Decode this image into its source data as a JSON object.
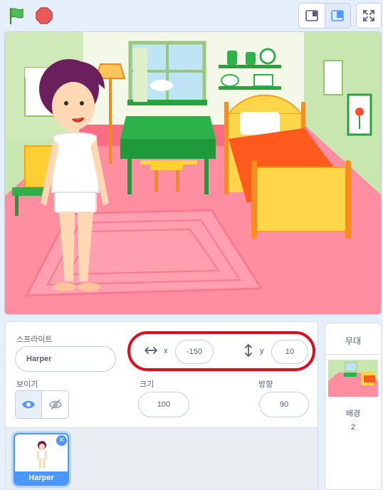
{
  "sprite_info": {
    "sprite_label": "스프라이트",
    "sprite_name": "Harper",
    "x_label": "x",
    "x_value": "-150",
    "y_label": "y",
    "y_value": "10",
    "show_label": "보이기",
    "size_label": "크기",
    "size_value": "100",
    "direction_label": "방향",
    "direction_value": "90"
  },
  "sprite_list": [
    {
      "name": "Harper",
      "selected": true
    }
  ],
  "stage_pane": {
    "title": "무대",
    "backdrops_label": "배경",
    "backdrops_count": "2"
  },
  "colors": {
    "accent": "#4c97ff",
    "highlight": "#e00b1c",
    "flag_green": "#4cbf56",
    "stop_red": "#ec5959"
  },
  "icons": [
    "green-flag-icon",
    "stop-icon",
    "small-stage-icon",
    "normal-stage-icon",
    "fullscreen-icon",
    "x-arrows-icon",
    "y-arrows-icon",
    "eye-icon",
    "eye-slash-icon",
    "delete-sprite-icon"
  ]
}
